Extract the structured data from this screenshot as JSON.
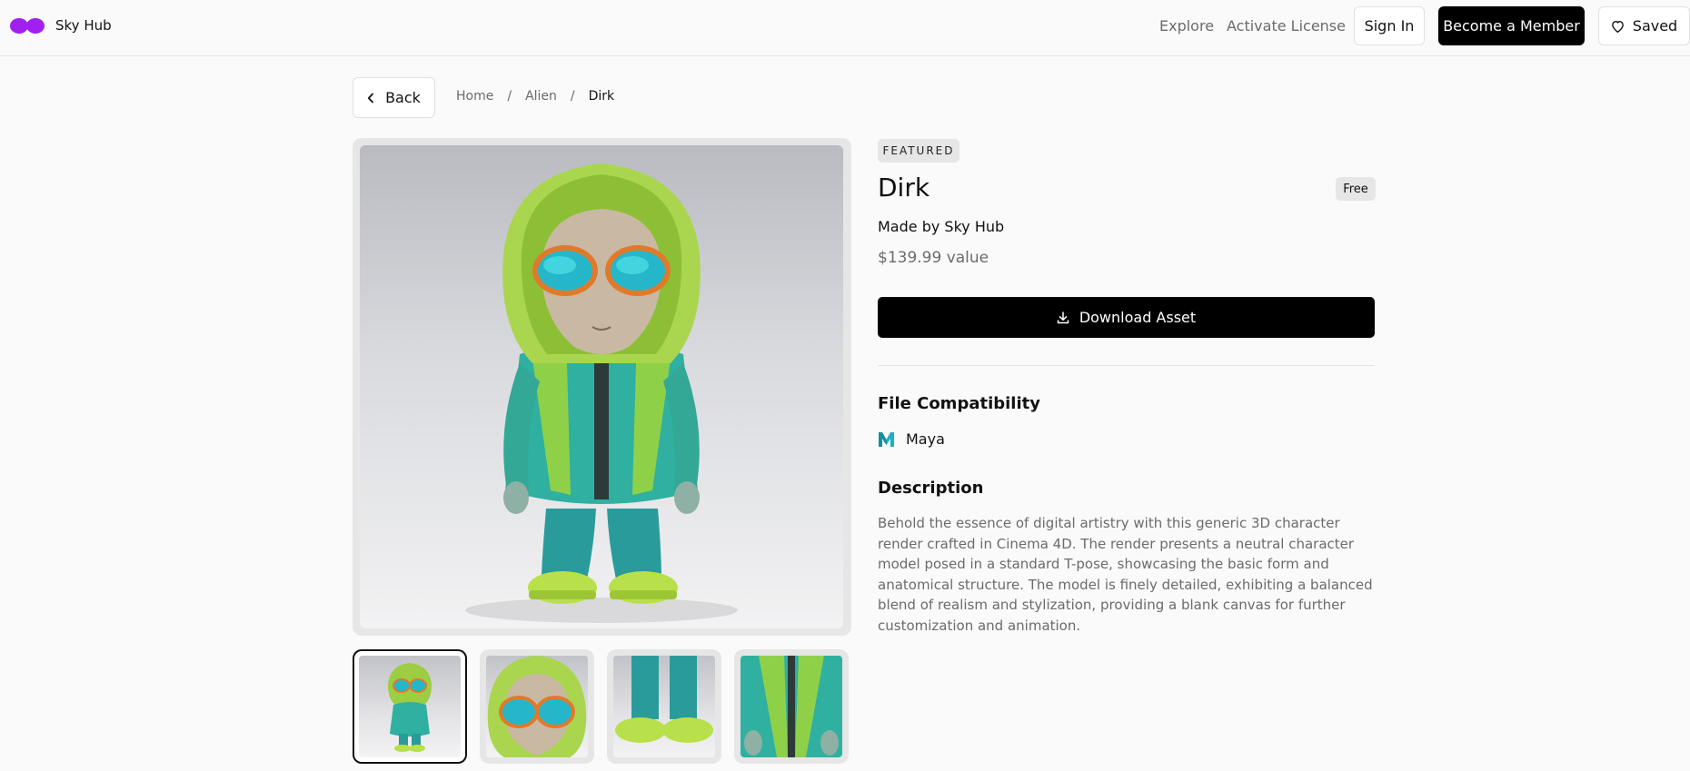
{
  "header": {
    "brand": "Sky Hub",
    "nav": {
      "explore": "Explore",
      "activate_license": "Activate License"
    },
    "sign_in": "Sign In",
    "become_member": "Become a Member",
    "saved": "Saved",
    "logo_color": "#a020f0",
    "icons": {
      "logo": "infinity-logo-icon",
      "saved": "heart-icon"
    }
  },
  "nav": {
    "back": "Back",
    "back_icon": "chevron-left-icon",
    "breadcrumb": [
      "Home",
      "Alien",
      "Dirk"
    ],
    "separator": "/"
  },
  "gallery": {
    "main_image": "alien character in green hoodie with sunglasses",
    "thumbnails": [
      {
        "content": "full body alien character",
        "active": true
      },
      {
        "content": "alien face with sunglasses close-up",
        "active": false
      },
      {
        "content": "legs and green sneakers close-up",
        "active": false
      },
      {
        "content": "jacket torso and hands close-up",
        "active": false
      }
    ]
  },
  "product": {
    "badge": "FEATURED",
    "title": "Dirk",
    "price_badge": "Free",
    "made_by": "Made by Sky Hub",
    "value": "$139.99 value",
    "download_label": "Download Asset",
    "download_icon": "download-icon",
    "compat_heading": "File Compatibility",
    "compat": [
      {
        "name": "Maya",
        "icon": "maya-logo-icon",
        "color": "#1cb0c4"
      }
    ],
    "description_heading": "Description",
    "description": "Behold the essence of digital artistry with this generic 3D character render crafted in Cinema 4D. The render presents a neutral character model posed in a standard T-pose, showcasing the basic form and anatomical structure. The model is finely detailed, exhibiting a balanced blend of realism and stylization, providing a blank canvas for further customization and animation."
  }
}
